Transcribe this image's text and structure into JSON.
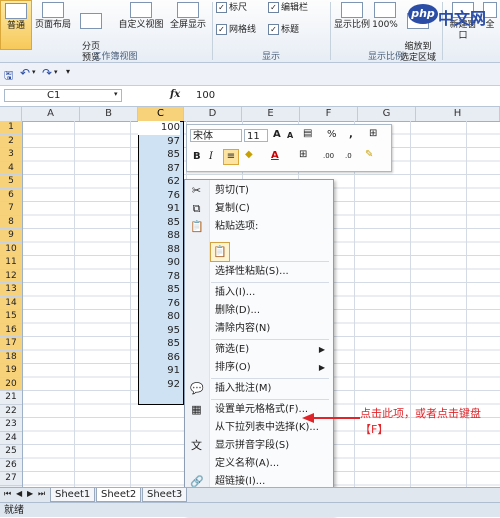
{
  "ribbon": {
    "buttons": [
      "普通",
      "页面布局",
      "分页\n预览",
      "自定义视图",
      "全屏显示"
    ],
    "view_group": "工作簿视图",
    "checks": {
      "ruler": "标尺",
      "gridlines": "网格线",
      "formula_bar": "编辑栏",
      "headings": "标题"
    },
    "show_group": "显示",
    "zoom_buttons": [
      "显示比例",
      "100%",
      "缩放到\n选定区域"
    ],
    "zoom_group": "显示比例",
    "new_window": "新建窗口",
    "all": "全"
  },
  "logo": {
    "badge": "php",
    "text": "中文网"
  },
  "formula_bar": {
    "name_box": "C1",
    "fx": "fx",
    "value": "100"
  },
  "columns": [
    "A",
    "B",
    "C",
    "D",
    "E",
    "F",
    "G",
    "H"
  ],
  "rows": [
    "1",
    "2",
    "3",
    "4",
    "5",
    "6",
    "7",
    "8",
    "9",
    "10",
    "11",
    "12",
    "13",
    "14",
    "15",
    "16",
    "17",
    "18",
    "19",
    "20",
    "21",
    "22",
    "23",
    "24",
    "25",
    "26",
    "27"
  ],
  "column_c_values": [
    "100",
    "97",
    "85",
    "87",
    "62",
    "76",
    "91",
    "85",
    "88",
    "88",
    "90",
    "78",
    "85",
    "76",
    "80",
    "95",
    "85",
    "86",
    "91",
    "92"
  ],
  "mini_toolbar": {
    "font": "宋体",
    "size": "11",
    "grow": "A",
    "shrink": "A",
    "percent": "%",
    "comma": ",",
    "bold": "B",
    "italic": "I",
    "font_color_letter": "A",
    "decimals_inc": ".00",
    "decimals_dec": ".0"
  },
  "context_menu": {
    "items": [
      {
        "label": "剪切(T)",
        "icon": "✂"
      },
      {
        "label": "复制(C)",
        "icon": "⧉"
      },
      {
        "label": "粘贴选项:",
        "icon": "📋"
      },
      {
        "label": "选择性粘贴(S)...",
        "icon": ""
      },
      {
        "label": "插入(I)...",
        "icon": ""
      },
      {
        "label": "删除(D)...",
        "icon": ""
      },
      {
        "label": "清除内容(N)",
        "icon": ""
      },
      {
        "label": "筛选(E)",
        "icon": "",
        "submenu": "▶"
      },
      {
        "label": "排序(O)",
        "icon": "",
        "submenu": "▶"
      },
      {
        "label": "插入批注(M)",
        "icon": "💬"
      },
      {
        "label": "设置单元格格式(F)...",
        "icon": "▦"
      },
      {
        "label": "从下拉列表中选择(K)...",
        "icon": ""
      },
      {
        "label": "显示拼音字段(S)",
        "icon": "文"
      },
      {
        "label": "定义名称(A)...",
        "icon": ""
      },
      {
        "label": "超链接(I)...",
        "icon": "🔗"
      }
    ]
  },
  "annotation": "点击此项，或者点击键盘【F】",
  "sheet_tabs": [
    "Sheet1",
    "Sheet2",
    "Sheet3"
  ],
  "status_bar": "就绪",
  "colors": {
    "selection": "#cfe2f3",
    "header_selected": "#f7d27a",
    "annotation": "#e0252a"
  }
}
